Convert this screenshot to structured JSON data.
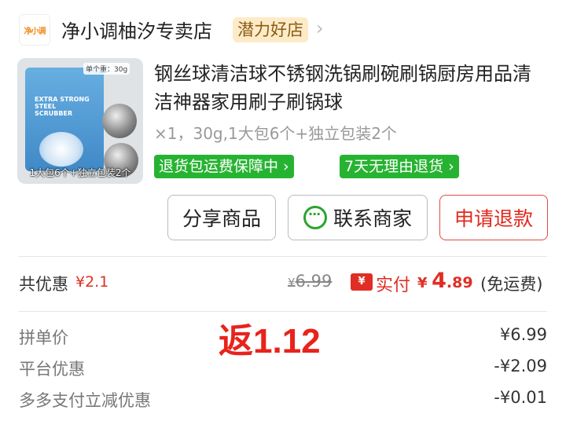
{
  "store": {
    "logo_text": "净小调",
    "name": "净小调柚汐专卖店",
    "badge": "潜力好店",
    "chevron": "›"
  },
  "product": {
    "image_unit_tag": "单个重：30g",
    "image_bag_text": "EXTRA STRONG STEEL SCRUBBER",
    "image_caption": "1大包6个+独立包装2个",
    "title": "钢丝球清洁球不锈钢洗锅刷碗刷锅厨房用品清洁神器家用刷子刷锅球",
    "spec": "×1，30g,1大包6个+独立包装2个",
    "tags": [
      "退货包运费保障中 ›",
      "7天无理由退货 ›"
    ]
  },
  "actions": {
    "share": "分享商品",
    "contact": "联系商家",
    "refund": "申请退款"
  },
  "summary": {
    "total_discount_label": "共优惠",
    "total_discount_value": "¥2.1",
    "original_currency": "¥",
    "original_price": "6.99",
    "ticket_icon": "¥",
    "paid_label": "实付",
    "paid_currency": "¥",
    "paid_int": "4",
    "paid_dec": ".89",
    "shipping": "(免运费)"
  },
  "breakdown": {
    "rows": [
      {
        "label": "拼单价",
        "value": "¥6.99"
      },
      {
        "label": "平台优惠",
        "value": "-¥2.09"
      },
      {
        "label": "多多支付立减优惠",
        "value": "-¥0.01"
      }
    ],
    "overlay": "返1.12"
  },
  "colors": {
    "accent_red": "#e02e24",
    "tag_green": "#27b332",
    "badge_bg": "#fdebc8"
  }
}
